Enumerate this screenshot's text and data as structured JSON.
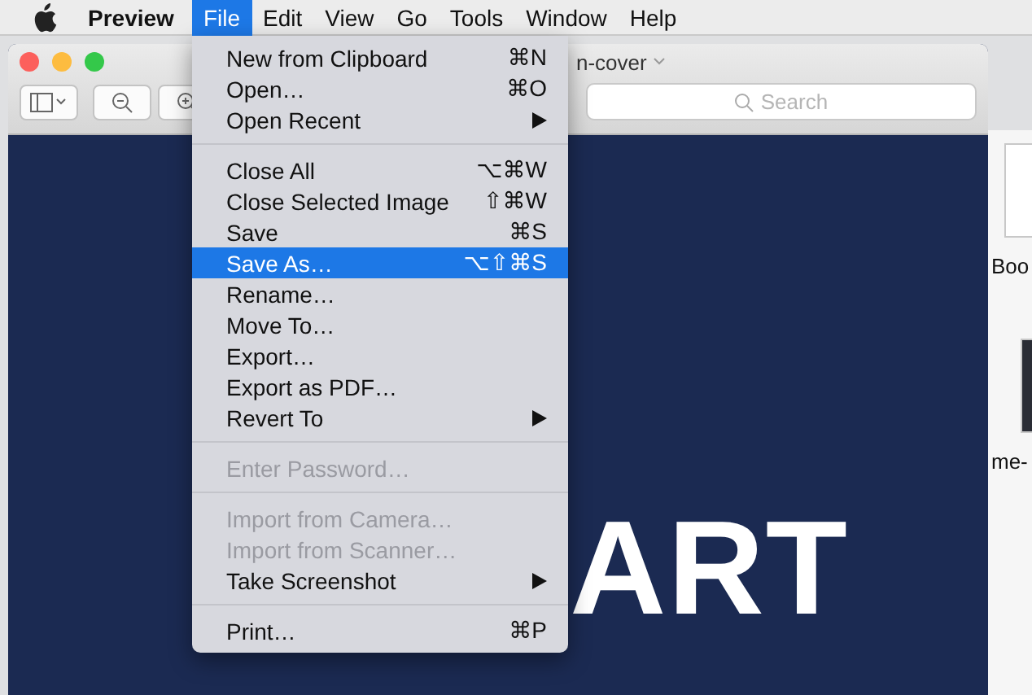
{
  "menu_bar": {
    "items": [
      {
        "label": "Preview",
        "kind": "app",
        "selected": false
      },
      {
        "label": "File",
        "kind": "menu",
        "selected": true
      },
      {
        "label": "Edit",
        "kind": "menu",
        "selected": false
      },
      {
        "label": "View",
        "kind": "menu",
        "selected": false
      },
      {
        "label": "Go",
        "kind": "menu",
        "selected": false
      },
      {
        "label": "Tools",
        "kind": "menu",
        "selected": false
      },
      {
        "label": "Window",
        "kind": "menu",
        "selected": false
      },
      {
        "label": "Help",
        "kind": "menu",
        "selected": false
      }
    ]
  },
  "file_menu": [
    {
      "kind": "item",
      "label": "New from Clipboard",
      "shortcut": "⌘N",
      "submenu": false,
      "disabled": false,
      "selected": false
    },
    {
      "kind": "item",
      "label": "Open…",
      "shortcut": "⌘O",
      "submenu": false,
      "disabled": false,
      "selected": false
    },
    {
      "kind": "item",
      "label": "Open Recent",
      "submenu": true,
      "disabled": false,
      "selected": false
    },
    {
      "kind": "separator"
    },
    {
      "kind": "item",
      "label": "Close All",
      "shortcut": "⌥⌘W",
      "submenu": false,
      "disabled": false,
      "selected": false
    },
    {
      "kind": "item",
      "label": "Close Selected Image",
      "shortcut": "⇧⌘W",
      "submenu": false,
      "disabled": false,
      "selected": false
    },
    {
      "kind": "item",
      "label": "Save",
      "shortcut": "⌘S",
      "submenu": false,
      "disabled": false,
      "selected": false
    },
    {
      "kind": "item",
      "label": "Save As…",
      "shortcut": "⌥⇧⌘S",
      "submenu": false,
      "disabled": false,
      "selected": true
    },
    {
      "kind": "item",
      "label": "Rename…",
      "submenu": false,
      "disabled": false,
      "selected": false
    },
    {
      "kind": "item",
      "label": "Move To…",
      "submenu": false,
      "disabled": false,
      "selected": false
    },
    {
      "kind": "item",
      "label": "Export…",
      "submenu": false,
      "disabled": false,
      "selected": false
    },
    {
      "kind": "item",
      "label": "Export as PDF…",
      "submenu": false,
      "disabled": false,
      "selected": false
    },
    {
      "kind": "item",
      "label": "Revert To",
      "submenu": true,
      "disabled": false,
      "selected": false
    },
    {
      "kind": "separator"
    },
    {
      "kind": "item",
      "label": "Enter Password…",
      "submenu": false,
      "disabled": true,
      "selected": false
    },
    {
      "kind": "separator"
    },
    {
      "kind": "item",
      "label": "Import from Camera…",
      "submenu": false,
      "disabled": true,
      "selected": false
    },
    {
      "kind": "item",
      "label": "Import from Scanner…",
      "submenu": false,
      "disabled": true,
      "selected": false
    },
    {
      "kind": "item",
      "label": "Take Screenshot",
      "submenu": true,
      "disabled": false,
      "selected": false
    },
    {
      "kind": "separator"
    },
    {
      "kind": "item",
      "label": "Print…",
      "shortcut": "⌘P",
      "submenu": false,
      "disabled": false,
      "selected": false
    }
  ],
  "preview_window": {
    "title": "n-cover",
    "search": {
      "placeholder": "Search"
    },
    "document_text": "ART"
  },
  "background_window": {
    "thumbnails": [
      {
        "label": "Boo",
        "kind": "page"
      },
      {
        "label": "me-",
        "kind": "photo"
      }
    ]
  }
}
